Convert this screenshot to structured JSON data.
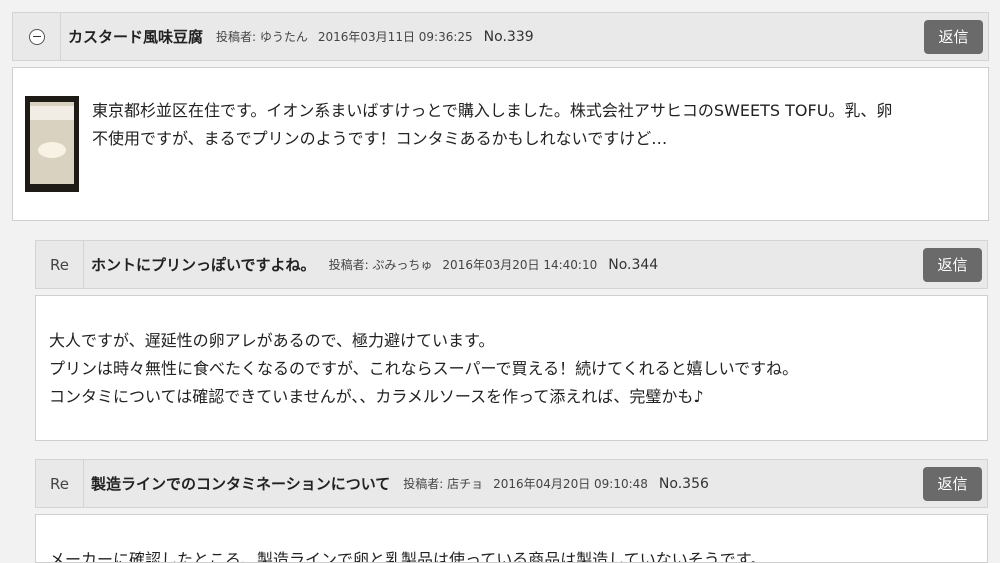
{
  "posts": [
    {
      "lead": "",
      "title": "カスタード風味豆腐",
      "author": "投稿者: ゆうたん",
      "datetime": "2016年03月11日 09:36:25",
      "number": "No.339",
      "reply_label": "返信",
      "body_lines": [
        "東京都杉並区在住です。イオン系まいばすけっとで購入しました。株式会社アサヒコのSWEETS TOFU。乳、卵",
        "不使用ですが、まるでプリンのようです！コンタミあるかもしれないですけど…"
      ]
    },
    {
      "lead": "Re",
      "title": "ホントにプリンっぽいですよね。",
      "author": "投稿者: ぷみっちゅ",
      "datetime": "2016年03月20日 14:40:10",
      "number": "No.344",
      "reply_label": "返信",
      "body_lines": [
        "大人ですが、遅延性の卵アレがあるので、極力避けています。",
        "プリンは時々無性に食べたくなるのですが、これならスーパーで買える！続けてくれると嬉しいですね。",
        "コンタミについては確認できていませんが、、カラメルソースを作って添えれば、完璧かも♪"
      ]
    },
    {
      "lead": "Re",
      "title": "製造ラインでのコンタミネーションについて",
      "author": "投稿者: 店チョ",
      "datetime": "2016年04月20日 09:10:48",
      "number": "No.356",
      "reply_label": "返信",
      "body_lines": [
        "メーカーに確認したところ、製造ラインで卵と乳製品は使っている商品は製造していないそうです。"
      ]
    }
  ]
}
